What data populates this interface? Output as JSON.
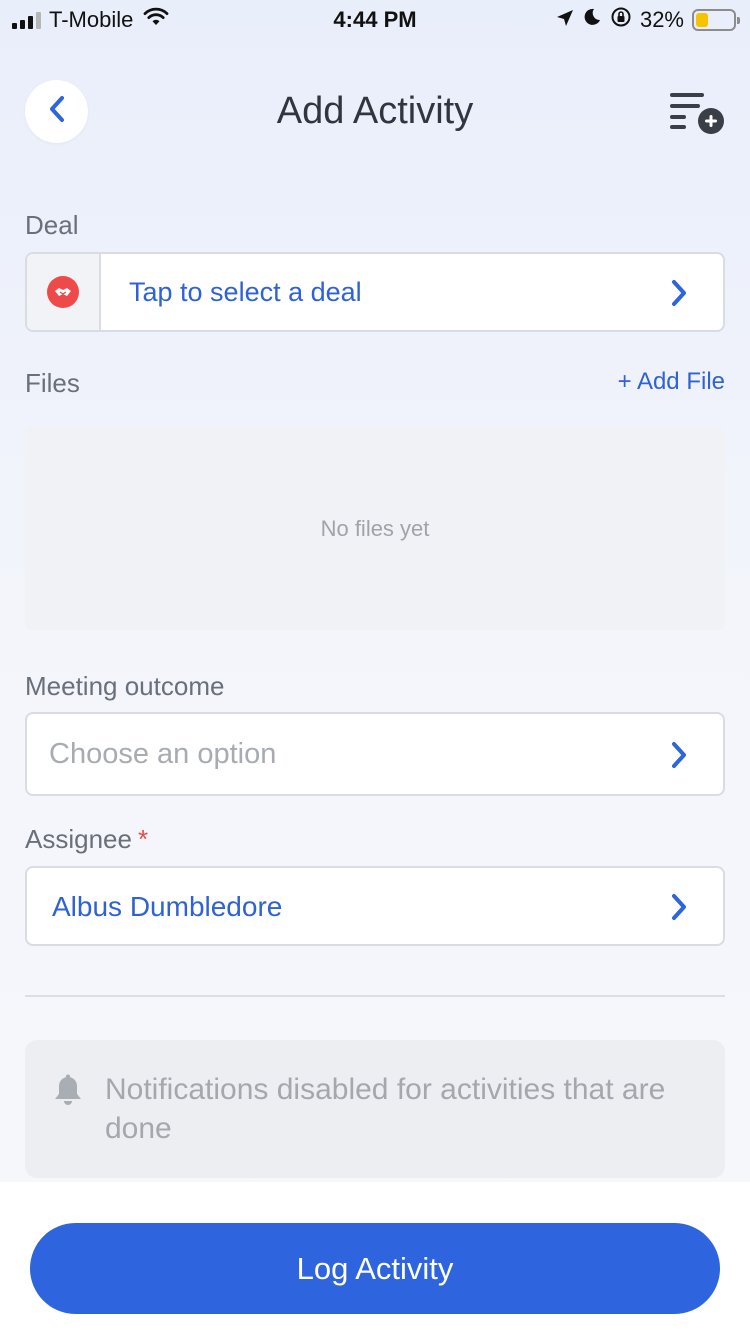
{
  "status_bar": {
    "carrier": "T-Mobile",
    "time": "4:44 PM",
    "battery_percent": "32%",
    "battery_level": 0.32,
    "icons": [
      "signal-icon",
      "wifi-icon",
      "location-icon",
      "moon-icon",
      "rotation-lock-icon",
      "battery-icon"
    ]
  },
  "header": {
    "title": "Add Activity",
    "back_icon": "chevron-left-icon",
    "action_icon": "list-add-icon"
  },
  "deal": {
    "label": "Deal",
    "placeholder": "Tap to select a deal",
    "icon": "handshake-icon"
  },
  "files": {
    "label": "Files",
    "add_label": "+ Add File",
    "empty_text": "No files yet"
  },
  "meeting_outcome": {
    "label": "Meeting outcome",
    "placeholder": "Choose an option"
  },
  "assignee": {
    "label": "Assignee",
    "required_mark": "*",
    "value": "Albus Dumbledore"
  },
  "notification": {
    "text": "Notifications disabled for activities that are done",
    "icon": "bell-icon"
  },
  "footer": {
    "log_button": "Log Activity"
  },
  "colors": {
    "accent": "#2e64dd",
    "link": "#2f62d3",
    "required": "#e84a4a",
    "deal_icon_bg": "#ef4a4a",
    "battery": "#f5c400"
  }
}
